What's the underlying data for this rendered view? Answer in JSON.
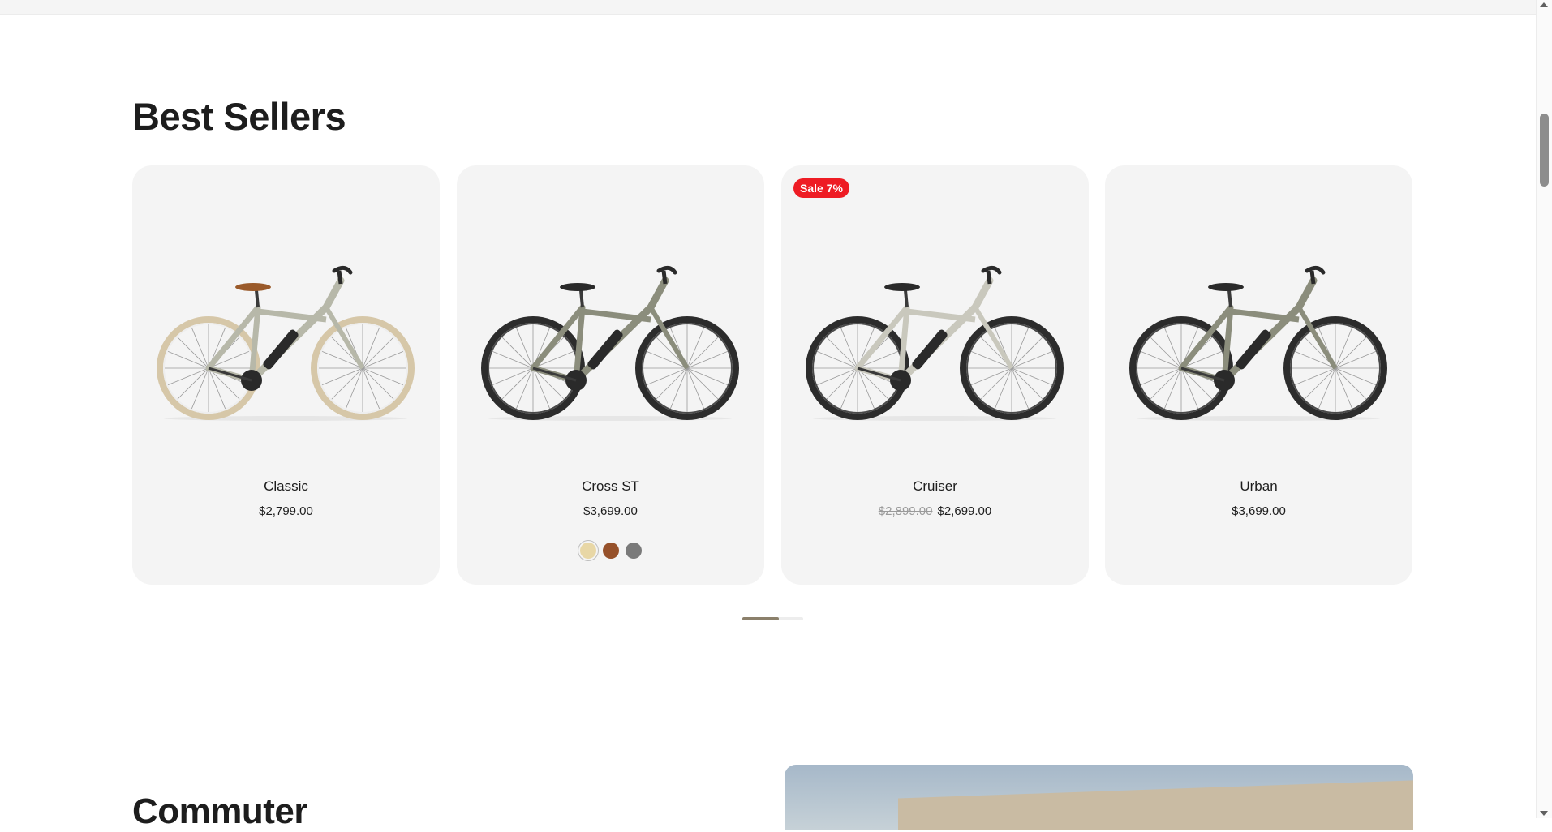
{
  "section": {
    "title": "Best Sellers"
  },
  "products": [
    {
      "name": "Classic",
      "price": "$2,799.00",
      "old_price": "",
      "badge": "",
      "wheel_tone": "light",
      "frame_color": "#b7b8a9"
    },
    {
      "name": "Cross ST",
      "price": "$3,699.00",
      "old_price": "",
      "badge": "",
      "wheel_tone": "dark",
      "frame_color": "#8b8d7c",
      "swatches": [
        {
          "color": "#e8d7a6",
          "selected": true
        },
        {
          "color": "#96512a",
          "selected": false
        },
        {
          "color": "#7a7a7a",
          "selected": false
        }
      ]
    },
    {
      "name": "Cruiser",
      "price": "$2,699.00",
      "old_price": "$2,899.00",
      "badge": "Sale 7%",
      "wheel_tone": "dark",
      "frame_color": "#c9c8bd"
    },
    {
      "name": "Urban",
      "price": "$3,699.00",
      "old_price": "",
      "badge": "",
      "wheel_tone": "dark",
      "frame_color": "#8b8d7c"
    }
  ],
  "carousel": {
    "progress": 0.6
  },
  "next_section": {
    "title": "Commuter"
  },
  "colors": {
    "badge": "#ee1c24",
    "card_bg": "#f4f4f4",
    "progress": "#8b806b"
  }
}
